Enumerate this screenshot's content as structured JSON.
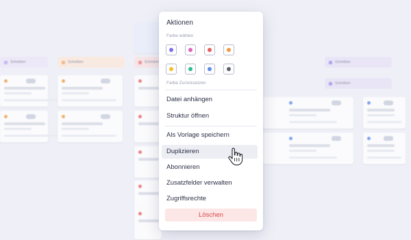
{
  "menu": {
    "title": "Aktionen",
    "color_section": "Farbe wählen",
    "reset_label": "Farbe Zurücksetzen",
    "swatches": [
      {
        "name": "purple",
        "color": "#7b6cf0"
      },
      {
        "name": "pink",
        "color": "#e35fbd"
      },
      {
        "name": "red",
        "color": "#ea5a5a"
      },
      {
        "name": "orange",
        "color": "#f29a3e"
      },
      {
        "name": "yellow",
        "color": "#f2be2c"
      },
      {
        "name": "teal",
        "color": "#2dbb8f"
      },
      {
        "name": "blue",
        "color": "#5a8bea"
      },
      {
        "name": "gray",
        "color": "#5d6070"
      }
    ],
    "items": {
      "attach": "Datei anhängen",
      "structure": "Struktur öffnen",
      "template": "Als Vorlage speichern",
      "duplicate": "Duplizieren",
      "subscribe": "Abonnieren",
      "fields": "Zusatzfelder verwalten",
      "access": "Zugriffsrechte",
      "delete": "Löschen"
    },
    "hovered_item": "duplicate"
  },
  "background": {
    "lanes": [
      {
        "label": "Schreiben",
        "color": "#e7e2f7"
      },
      {
        "label": "Schreiben",
        "color": "#fbe9da"
      },
      {
        "label": "Schreiben",
        "color": "#f9e1e1"
      },
      {
        "label": "Schreiben",
        "color": "#e7e2f7"
      },
      {
        "label": "Schreiben",
        "color": "#e7e2f7"
      }
    ]
  },
  "icons": {
    "cursor": "hand-pointer-icon"
  }
}
